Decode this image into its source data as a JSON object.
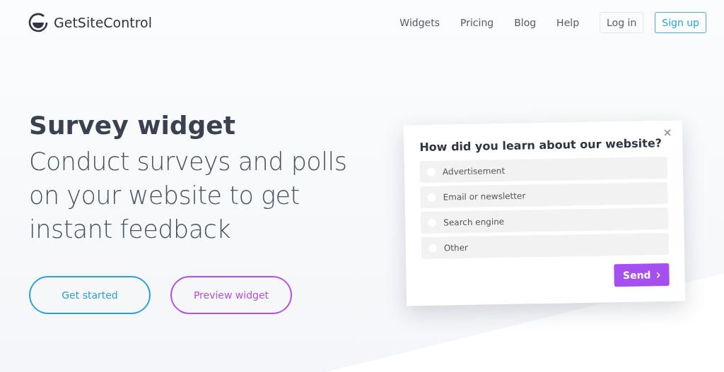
{
  "header": {
    "logo": "GetSiteControl",
    "nav": [
      "Widgets",
      "Pricing",
      "Blog",
      "Help"
    ],
    "login": "Log in",
    "signup": "Sign up"
  },
  "hero": {
    "title": "Survey widget",
    "subtitle": "Conduct surveys and polls on your website to get instant feedback",
    "buttons": [
      {
        "label": "Get started",
        "kind": "primary"
      },
      {
        "label": "Preview widget",
        "kind": "secondary"
      }
    ]
  },
  "survey": {
    "question": "How did you learn about our website?",
    "options": [
      {
        "label": "Advertisement",
        "selected": false
      },
      {
        "label": "Email or newsletter",
        "selected": false
      },
      {
        "label": "Search engine",
        "selected": false
      },
      {
        "label": "Other",
        "selected": false
      }
    ],
    "send": "Send"
  }
}
